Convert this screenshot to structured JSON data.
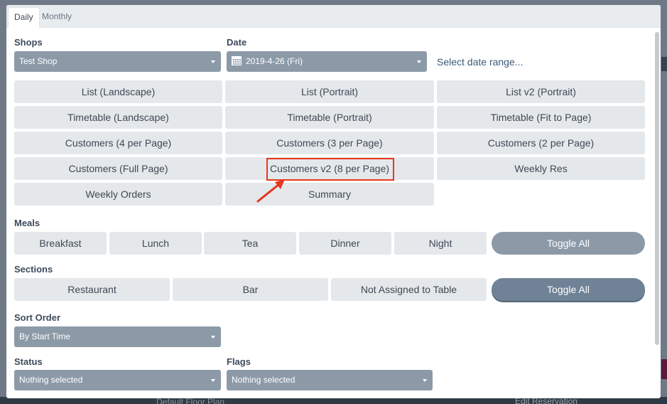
{
  "tabs": [
    {
      "label": "Daily",
      "active": true
    },
    {
      "label": "Monthly",
      "active": false
    }
  ],
  "shops": {
    "label": "Shops",
    "value": "Test Shop"
  },
  "date": {
    "label": "Date",
    "value": "2019-4-26 (Fri)",
    "range_link": "Select date range..."
  },
  "report_buttons": [
    "List (Landscape)",
    "List (Portrait)",
    "List v2 (Portrait)",
    "Timetable (Landscape)",
    "Timetable (Portrait)",
    "Timetable (Fit to Page)",
    "Customers (4 per Page)",
    "Customers (3 per Page)",
    "Customers (2 per Page)",
    "Customers (Full Page)",
    "Customers v2 (8 per Page)",
    "Weekly Res",
    "Weekly Orders",
    "Summary"
  ],
  "meals": {
    "label": "Meals",
    "items": [
      "Breakfast",
      "Lunch",
      "Tea",
      "Dinner",
      "Night"
    ],
    "toggle_all": "Toggle All"
  },
  "sections": {
    "label": "Sections",
    "items": [
      "Restaurant",
      "Bar",
      "Not Assigned to Table"
    ],
    "toggle_all": "Toggle All"
  },
  "sort_order": {
    "label": "Sort Order",
    "value": "By Start Time"
  },
  "status": {
    "label": "Status",
    "value": "Nothing selected"
  },
  "flags": {
    "label": "Flags",
    "value": "Nothing selected"
  },
  "background": {
    "bottom_left": "Default Floor Plan",
    "bottom_right": "Edit Reservation"
  },
  "colors": {
    "accent_select": "#8c9aa8",
    "toggle_dark": "#6f8296",
    "highlight": "#e8361e"
  }
}
